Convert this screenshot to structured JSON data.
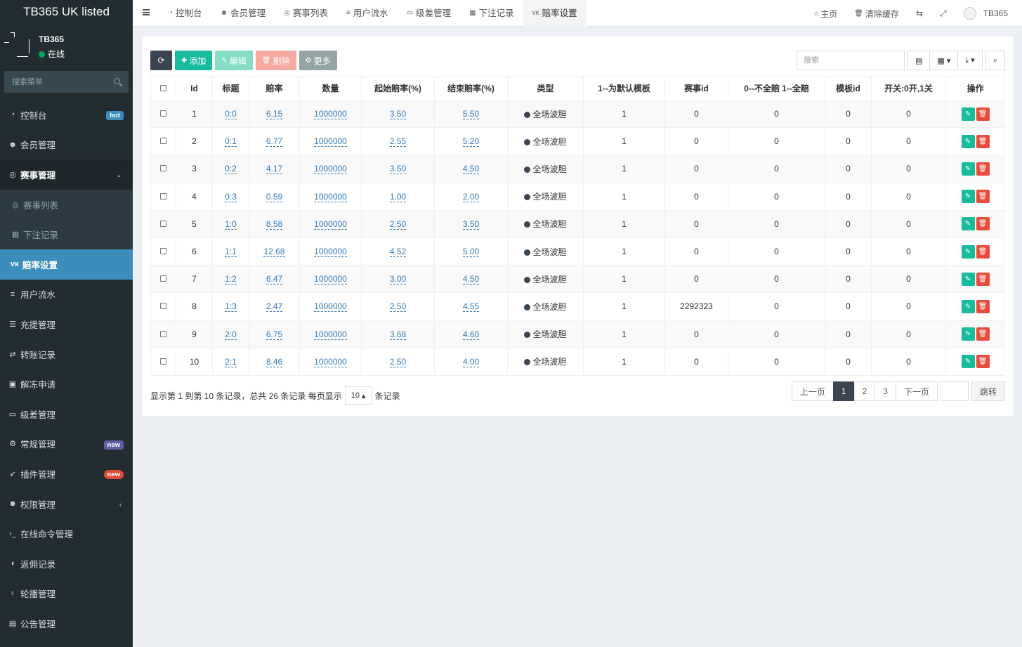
{
  "app_title": "TB365 UK listed",
  "user": {
    "name": "TB365",
    "status": "在线"
  },
  "sidebar": {
    "search_placeholder": "搜索菜单",
    "items": [
      {
        "label": "控制台",
        "icon": "dashboard-icon",
        "badge": "hot"
      },
      {
        "label": "会员管理",
        "icon": "users-icon"
      },
      {
        "label": "赛事管理",
        "icon": "lifebuoy-icon",
        "open": true
      },
      {
        "label": "赛事列表",
        "icon": "lifebuoy-icon",
        "sub": true
      },
      {
        "label": "下注记录",
        "icon": "calendar-icon",
        "sub": true
      },
      {
        "label": "赔率设置",
        "icon": "vk-icon",
        "active": true
      },
      {
        "label": "用户流水",
        "icon": "list-icon"
      },
      {
        "label": "充提管理",
        "icon": "list-alt-icon"
      },
      {
        "label": "转账记录",
        "icon": "exchange-icon"
      },
      {
        "label": "解冻申请",
        "icon": "image-icon"
      },
      {
        "label": "级差管理",
        "icon": "window-icon"
      },
      {
        "label": "常规管理",
        "icon": "cogs-icon",
        "badge": "new"
      },
      {
        "label": "插件管理",
        "icon": "rocket-icon",
        "badge": "new"
      },
      {
        "label": "权限管理",
        "icon": "group-icon"
      },
      {
        "label": "在线命令管理",
        "icon": "terminal-icon"
      },
      {
        "label": "返佣记录",
        "icon": "volume-icon"
      },
      {
        "label": "轮播管理",
        "icon": "venus-icon"
      },
      {
        "label": "公告管理",
        "icon": "newspaper-icon"
      }
    ]
  },
  "topbar": {
    "tabs": [
      {
        "label": "控制台",
        "icon": "dashboard-icon"
      },
      {
        "label": "会员管理",
        "icon": "users-icon"
      },
      {
        "label": "赛事列表",
        "icon": "lifebuoy-icon"
      },
      {
        "label": "用户流水",
        "icon": "list-icon"
      },
      {
        "label": "级差管理",
        "icon": "window-icon"
      },
      {
        "label": "下注记录",
        "icon": "calendar-icon"
      },
      {
        "label": "赔率设置",
        "icon": "vk-icon",
        "active": true
      }
    ],
    "home": "主页",
    "clear_cache": "清除缓存",
    "username": "TB365"
  },
  "toolbar": {
    "add": "添加",
    "edit": "编辑",
    "delete": "删除",
    "more": "更多",
    "search_placeholder": "搜索"
  },
  "table": {
    "headers": [
      "Id",
      "标题",
      "赔率",
      "数量",
      "起始赔率(%)",
      "结束赔率(%)",
      "类型",
      "1--为默认模板",
      "赛事id",
      "0--不全赔 1--全赔",
      "模板id",
      "开关:0开,1关",
      "操作"
    ],
    "rows": [
      [
        "1",
        "0:0",
        "6.15",
        "1000000",
        "3.50",
        "5.50",
        "全场波胆",
        "1",
        "0",
        "0",
        "0",
        "0"
      ],
      [
        "2",
        "0:1",
        "6.77",
        "1000000",
        "2.55",
        "5.20",
        "全场波胆",
        "1",
        "0",
        "0",
        "0",
        "0"
      ],
      [
        "3",
        "0:2",
        "4.17",
        "1000000",
        "3.50",
        "4.50",
        "全场波胆",
        "1",
        "0",
        "0",
        "0",
        "0"
      ],
      [
        "4",
        "0:3",
        "0.59",
        "1000000",
        "1.00",
        "2.00",
        "全场波胆",
        "1",
        "0",
        "0",
        "0",
        "0"
      ],
      [
        "5",
        "1:0",
        "8.58",
        "1000000",
        "2.50",
        "3.50",
        "全场波胆",
        "1",
        "0",
        "0",
        "0",
        "0"
      ],
      [
        "6",
        "1:1",
        "12.68",
        "1000000",
        "4.52",
        "5.00",
        "全场波胆",
        "1",
        "0",
        "0",
        "0",
        "0"
      ],
      [
        "7",
        "1:2",
        "6.47",
        "1000000",
        "3.00",
        "4.50",
        "全场波胆",
        "1",
        "0",
        "0",
        "0",
        "0"
      ],
      [
        "8",
        "1:3",
        "2.47",
        "1000000",
        "2.50",
        "4.55",
        "全场波胆",
        "1",
        "2292323",
        "0",
        "0",
        "0"
      ],
      [
        "9",
        "2:0",
        "6.75",
        "1000000",
        "3.68",
        "4.60",
        "全场波胆",
        "1",
        "0",
        "0",
        "0",
        "0"
      ],
      [
        "10",
        "2:1",
        "8.46",
        "1000000",
        "2.50",
        "4.00",
        "全场波胆",
        "1",
        "0",
        "0",
        "0",
        "0"
      ]
    ]
  },
  "footer": {
    "info": "显示第 1 到第 10 条记录，总共 26 条记录 每页显示",
    "page_size": "10",
    "suffix": "条记录",
    "prev": "上一页",
    "pages": [
      "1",
      "2",
      "3"
    ],
    "next": "下一页",
    "jump": "跳转"
  },
  "colors": {
    "sidebar_bg": "#222d32",
    "active": "#3c8dbc",
    "success": "#18bc9c",
    "danger": "#e74c3c",
    "dark": "#3b4453"
  }
}
